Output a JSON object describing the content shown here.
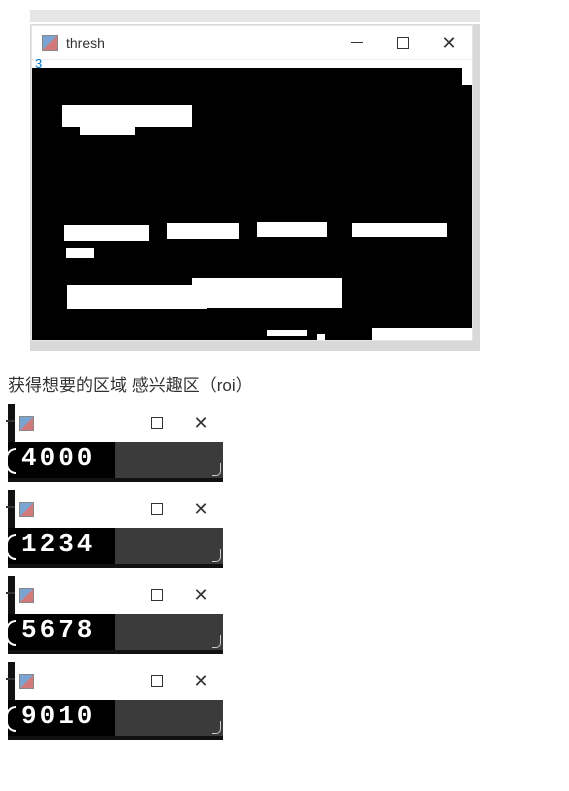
{
  "line_number": "3",
  "thresh_window": {
    "title": "thresh"
  },
  "caption": "获得想要的区域 感兴趣区（roi）",
  "roi": [
    {
      "digits": "4000"
    },
    {
      "digits": "1234"
    },
    {
      "digits": "5678"
    },
    {
      "digits": "9010"
    }
  ]
}
